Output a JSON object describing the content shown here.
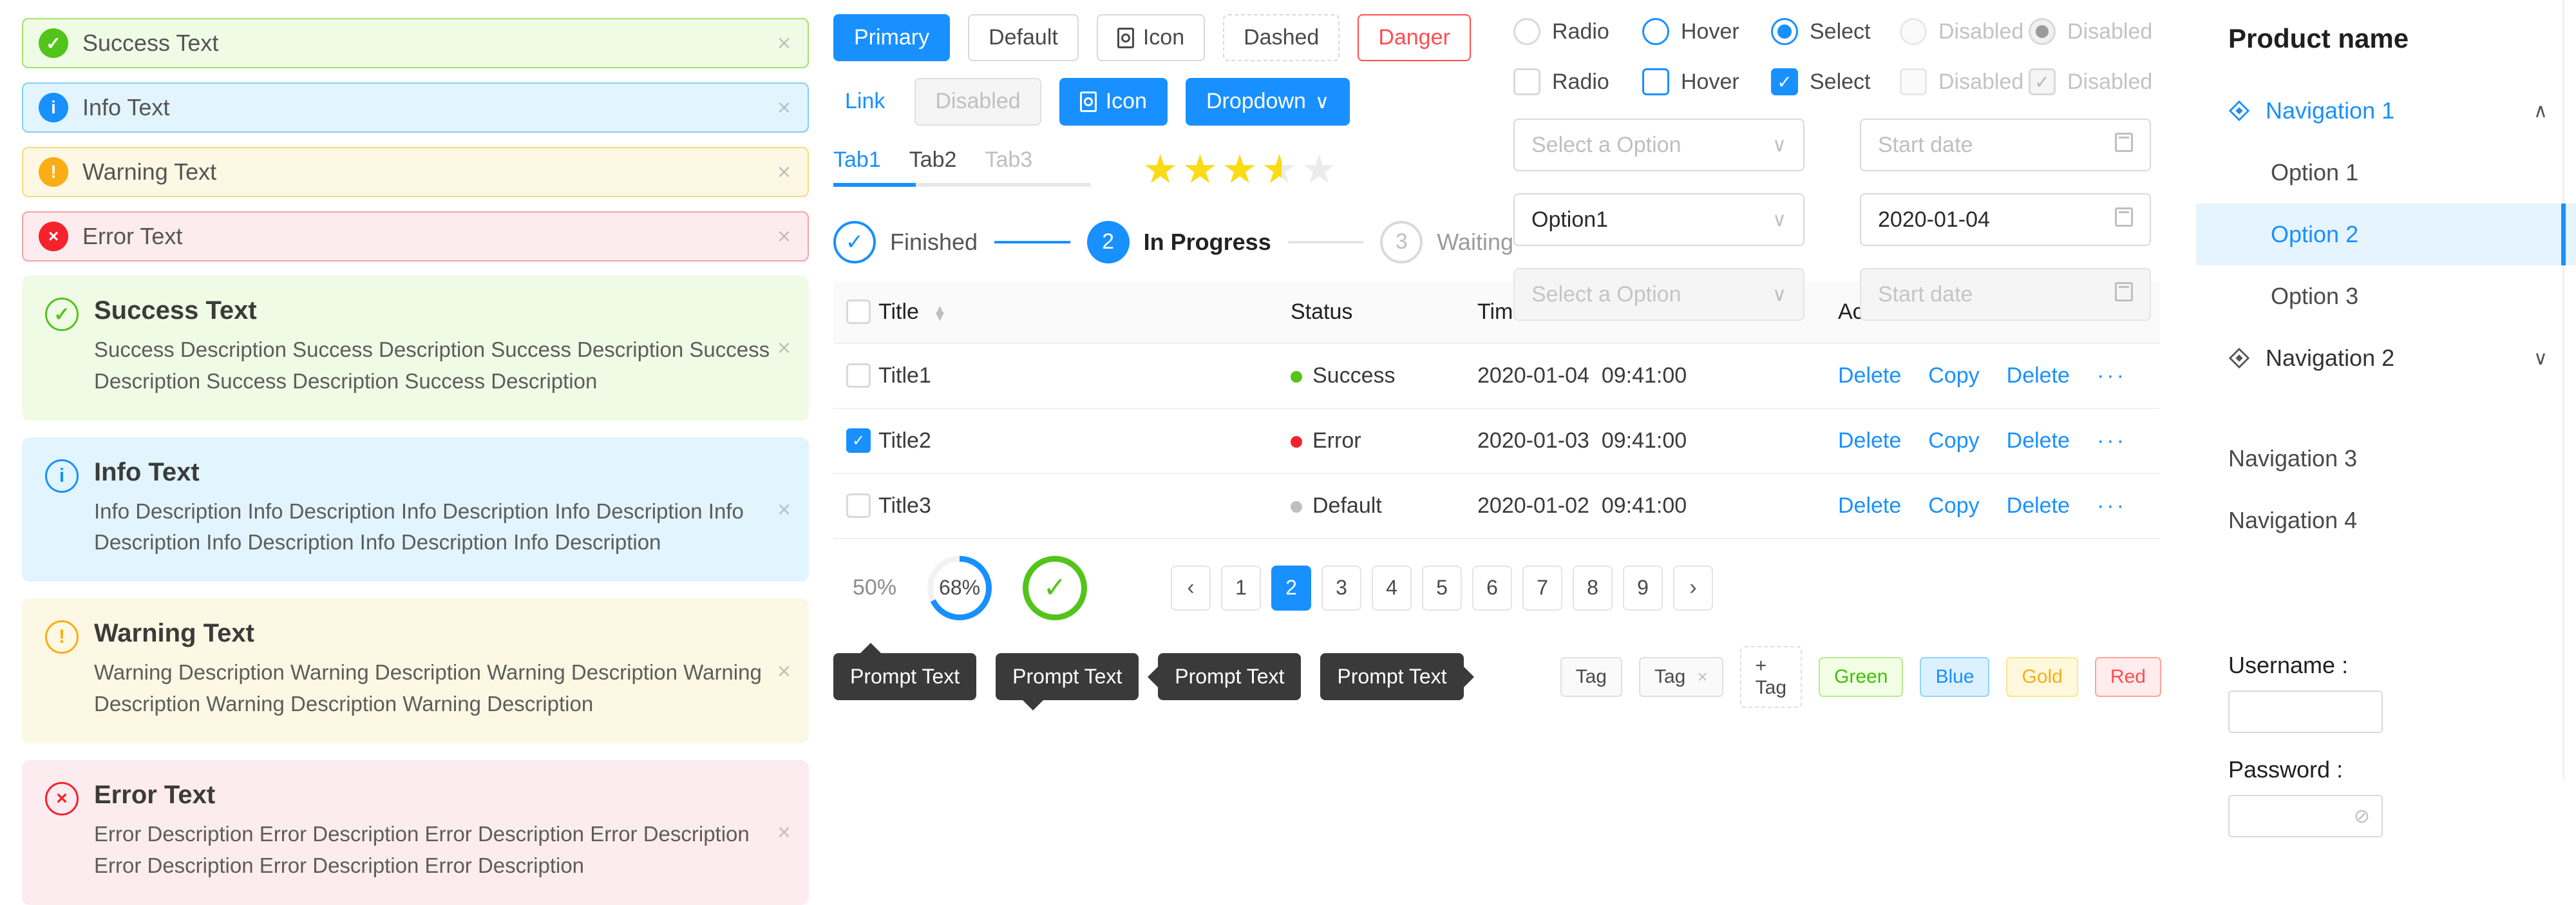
{
  "alerts_slim": [
    {
      "type": "success",
      "title": "Success Text",
      "icon": "check-circle-icon",
      "glyph": "✓",
      "close": "×"
    },
    {
      "type": "info",
      "title": "Info Text",
      "icon": "info-circle-icon",
      "glyph": "i",
      "close": "×"
    },
    {
      "type": "warning",
      "title": "Warning Text",
      "icon": "warning-circle-icon",
      "glyph": "!",
      "close": "×"
    },
    {
      "type": "error",
      "title": "Error Text",
      "icon": "close-circle-icon",
      "glyph": "×",
      "close": "×"
    }
  ],
  "alerts_card": [
    {
      "type": "success",
      "title": "Success Text",
      "glyph": "✓",
      "close": "×",
      "desc": "Success Description Success Description Success Description Success Description Success Description Success Description"
    },
    {
      "type": "info",
      "title": "Info Text",
      "glyph": "i",
      "close": "×",
      "desc": "Info Description Info Description Info Description Info Description Info Description Info Description Info Description Info Description"
    },
    {
      "type": "warning",
      "title": "Warning Text",
      "glyph": "!",
      "close": "×",
      "desc": "Warning Description Warning Description Warning Description Warning Description Warning Description Warning Description"
    },
    {
      "type": "error",
      "title": "Error Text",
      "glyph": "×",
      "close": "×",
      "desc": "Error Description Error Description Error Description Error Description Error Description Error Description Error Description"
    }
  ],
  "buttons": {
    "row1": [
      {
        "label": "Primary",
        "style": "primary"
      },
      {
        "label": "Default",
        "style": "default"
      },
      {
        "label": "Icon",
        "style": "default",
        "icon": "document-icon"
      },
      {
        "label": "Dashed",
        "style": "dashed"
      },
      {
        "label": "Danger",
        "style": "danger"
      }
    ],
    "row2": [
      {
        "label": "Link",
        "style": "link"
      },
      {
        "label": "Disabled",
        "style": "disabled"
      },
      {
        "label": "Icon",
        "style": "primary",
        "icon": "document-icon"
      },
      {
        "label": "Dropdown",
        "style": "primary",
        "caret": "∨"
      }
    ]
  },
  "tabs": {
    "items": [
      "Tab1",
      "Tab2",
      "Tab3"
    ],
    "active": "Tab1"
  },
  "rating": {
    "value": 3.5,
    "max": 5
  },
  "steps": [
    {
      "label": "Finished",
      "state": "done",
      "marker": "✓"
    },
    {
      "label": "In Progress",
      "state": "current",
      "marker": "2"
    },
    {
      "label": "Waiting",
      "state": "waiting",
      "marker": "3"
    }
  ],
  "radios": [
    {
      "label": "Radio",
      "state": "normal"
    },
    {
      "label": "Hover",
      "state": "hover"
    },
    {
      "label": "Select",
      "state": "selected"
    },
    {
      "label": "Disabled",
      "state": "disabled"
    },
    {
      "label": "Disabled",
      "state": "disabled-checked"
    }
  ],
  "checkboxes": [
    {
      "label": "Radio",
      "state": "normal"
    },
    {
      "label": "Hover",
      "state": "hover"
    },
    {
      "label": "Select",
      "state": "selected",
      "glyph": "✓"
    },
    {
      "label": "Disabled",
      "state": "disabled"
    },
    {
      "label": "Disabled",
      "state": "disabled-checked",
      "glyph": "✓"
    }
  ],
  "fields": [
    {
      "kind": "select",
      "value": "",
      "placeholder": "Select a Option",
      "state": "empty",
      "tail": "∨"
    },
    {
      "kind": "datepicker",
      "value": "",
      "placeholder": "Start date",
      "state": "empty",
      "tail": "calendar-icon"
    },
    {
      "kind": "select",
      "value": "Option1",
      "placeholder": "Select a Option",
      "state": "filled",
      "tail": "∨"
    },
    {
      "kind": "datepicker",
      "value": "2020-01-04",
      "placeholder": "Start date",
      "state": "filled",
      "tail": "calendar-icon"
    },
    {
      "kind": "select",
      "value": "",
      "placeholder": "Select a Option",
      "state": "disabled",
      "tail": "∨"
    },
    {
      "kind": "datepicker",
      "value": "",
      "placeholder": "Start date",
      "state": "disabled",
      "tail": "calendar-icon"
    }
  ],
  "table": {
    "columns": [
      {
        "key": "check",
        "label": "",
        "sortable": false
      },
      {
        "key": "title",
        "label": "Title",
        "sortable": true
      },
      {
        "key": "status",
        "label": "Status",
        "sortable": false
      },
      {
        "key": "time",
        "label": "Time",
        "sortable": true
      },
      {
        "key": "action",
        "label": "Action",
        "sortable": false
      }
    ],
    "actions": [
      "Delete",
      "Copy",
      "Delete"
    ],
    "more": "···",
    "rows": [
      {
        "checked": false,
        "title": "Title1",
        "status": "Success",
        "status_color": "green",
        "date": "2020-01-04",
        "time": "09:41:00"
      },
      {
        "checked": true,
        "title": "Title2",
        "status": "Error",
        "status_color": "red",
        "date": "2020-01-03",
        "time": "09:41:00"
      },
      {
        "checked": false,
        "title": "Title3",
        "status": "Default",
        "status_color": "gray",
        "date": "2020-01-02",
        "time": "09:41:00"
      }
    ]
  },
  "progress": {
    "bar_percent": 50,
    "bar_label": "50%",
    "circle_percent": 68,
    "circle_label": "68%",
    "circle_success_glyph": "✓"
  },
  "pagination": {
    "prev": "‹",
    "next": "›",
    "pages": [
      "1",
      "2",
      "3",
      "4",
      "5",
      "6",
      "7",
      "8",
      "9"
    ],
    "current": "2"
  },
  "tooltips": [
    {
      "text": "Prompt Text",
      "arrow": "top"
    },
    {
      "text": "Prompt Text",
      "arrow": "bottom"
    },
    {
      "text": "Prompt Text",
      "arrow": "left"
    },
    {
      "text": "Prompt Text",
      "arrow": "right"
    }
  ],
  "tags": [
    {
      "label": "Tag",
      "variant": "default",
      "closable": false
    },
    {
      "label": "Tag",
      "variant": "default",
      "closable": true,
      "close": "×"
    },
    {
      "label": "+ Tag",
      "variant": "add",
      "closable": false
    },
    {
      "label": "Green",
      "variant": "green",
      "closable": false
    },
    {
      "label": "Blue",
      "variant": "blue",
      "closable": false
    },
    {
      "label": "Gold",
      "variant": "gold",
      "closable": false
    },
    {
      "label": "Red",
      "variant": "red",
      "closable": false
    }
  ],
  "sidebar": {
    "product_name": "Product name",
    "nav": [
      {
        "label": "Navigation 1",
        "icon": "diamond-icon",
        "active": true,
        "expanded": true,
        "chevron": "∧"
      },
      {
        "label": "Navigation 2",
        "icon": "diamond-icon",
        "active": false,
        "expanded": false,
        "chevron": "∨"
      }
    ],
    "sub_items": [
      {
        "label": "Option 1",
        "selected": false
      },
      {
        "label": "Option 2",
        "selected": true
      },
      {
        "label": "Option 3",
        "selected": false
      }
    ],
    "plain_items": [
      {
        "label": "Navigation 3"
      },
      {
        "label": "Navigation 4"
      }
    ],
    "form": {
      "username_label": "Username :",
      "username_value": "",
      "password_label": "Password :",
      "password_value": "",
      "eye_icon": "⊘"
    }
  },
  "colors": {
    "primary": "#1890ff",
    "success": "#52c41a",
    "warning": "#faad14",
    "error": "#f5222d",
    "star": "#fadb14"
  }
}
